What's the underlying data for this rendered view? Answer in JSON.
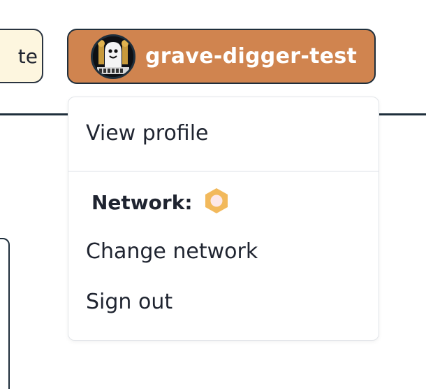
{
  "header": {
    "left_button_text": "te",
    "account": {
      "name": "grave-digger-test",
      "avatar_icon": "ghost-avatar-icon",
      "button_color": "#d0844f"
    }
  },
  "dropdown": {
    "view_profile": "View profile",
    "network_label": "Network:",
    "network_icon": "hexagon-network-icon",
    "network_icon_color": "#f2b95c",
    "change_network": "Change network",
    "sign_out": "Sign out"
  }
}
